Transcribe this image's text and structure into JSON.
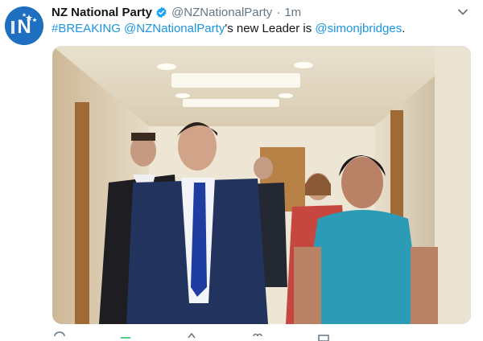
{
  "tweet": {
    "author_name": "NZ National Party",
    "handle": "@NZNationalParty",
    "separator": "·",
    "time": "1m",
    "avatar_icon": "nz-national-party-logo",
    "verified_icon": "verified-badge-icon",
    "menu_icon": "chevron-down-icon",
    "text": {
      "hashtag": "#BREAKING",
      "space1": " ",
      "mention1": "@NZNationalParty",
      "middle": "'s new Leader is ",
      "mention2": "@simonjbridges",
      "end": "."
    },
    "media_description_icon": "photo-image",
    "colors": {
      "link": "#1b95e0",
      "name": "#14171a",
      "meta": "#657786",
      "avatar_bg": "#1f6fc0",
      "verified": "#1da1f2"
    },
    "action_icons": [
      "reply-icon",
      "retweet-icon",
      "share-icon",
      "like-icon",
      "message-icon"
    ]
  }
}
